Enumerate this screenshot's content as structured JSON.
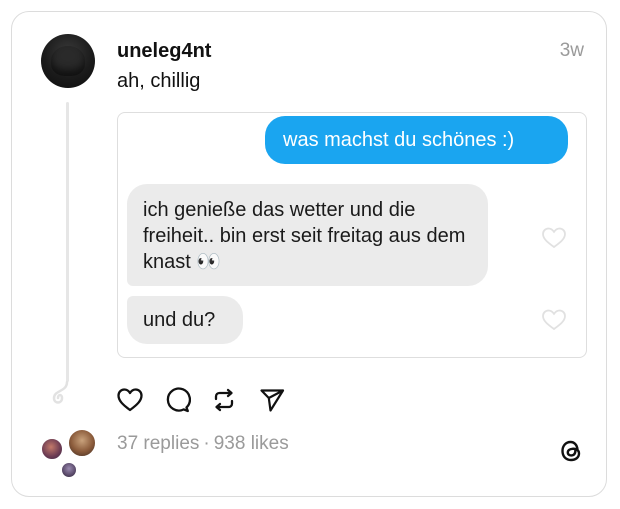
{
  "post": {
    "username": "uneleg4nt",
    "timestamp": "3w",
    "caption": "ah, chillig"
  },
  "screenshot": {
    "outgoing_message": "was machst du schönes :)",
    "incoming_messages": [
      {
        "text": "ich genieße das wetter und die freiheit.. bin erst seit freitag aus dem knast 👀"
      },
      {
        "text": "und du?"
      }
    ],
    "colors": {
      "outgoing_bubble": "#1aa5f0",
      "incoming_bubble": "#ebebeb"
    }
  },
  "actions": {
    "like_icon": "heart-outline-icon",
    "reply_icon": "comment-bubble-icon",
    "repost_icon": "repost-arrows-icon",
    "share_icon": "send-paper-plane-icon"
  },
  "stats": {
    "replies": "37 replies",
    "separator": "·",
    "likes": "938 likes"
  },
  "brand": {
    "logo_icon": "threads-logo-icon"
  }
}
